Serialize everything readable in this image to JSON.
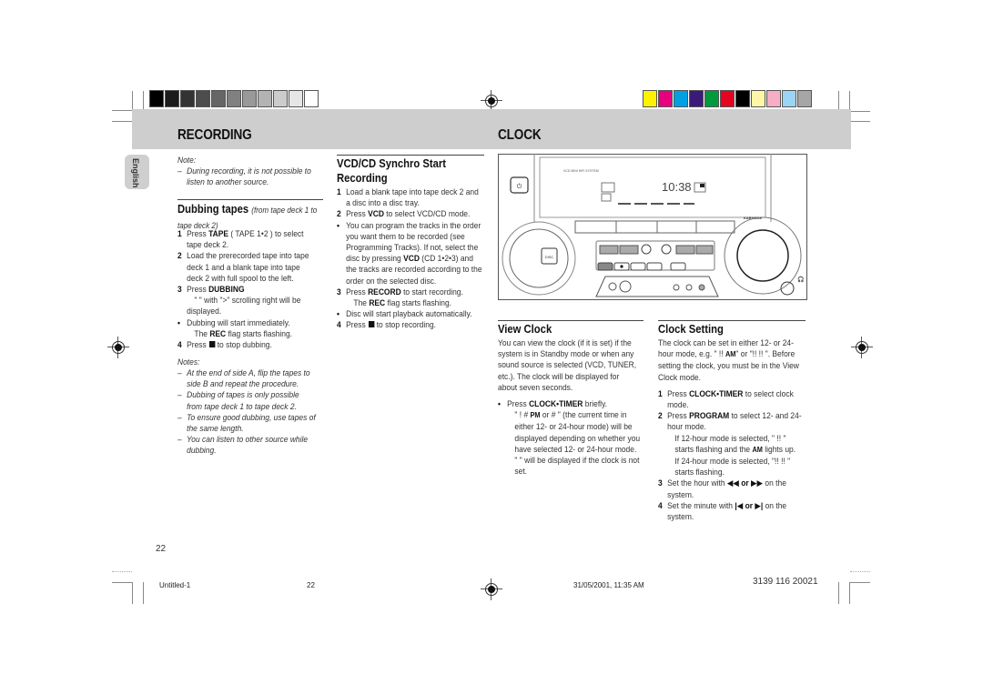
{
  "header": {
    "left_title": "RECORDING",
    "right_title": "CLOCK",
    "language_tab": "English"
  },
  "swatches": {
    "gray": [
      "#000000",
      "#1c1c1c",
      "#333333",
      "#4d4d4d",
      "#666666",
      "#808080",
      "#999999",
      "#b3b3b3",
      "#cccccc",
      "#e6e6e6",
      "#ffffff"
    ],
    "color": [
      "#fff200",
      "#e6007e",
      "#00a0e3",
      "#3b1a7a",
      "#009a3e",
      "#e30521",
      "#000000",
      "#fff6a8",
      "#f6adc6",
      "#9bd4f5",
      "#a6a6a6"
    ]
  },
  "col1": {
    "note_label": "Note:",
    "note_text": "During recording, it is not possible to listen to another source.",
    "dubbing_title": "Dubbing tapes",
    "dubbing_subtitle": "(from tape deck 1 to tape deck 2)",
    "steps": [
      {
        "n": "1",
        "pre": "Press ",
        "bold": "TAPE",
        "post": " ( TAPE 1•2 ) to select tape deck 2."
      },
      {
        "n": "2",
        "pre": "Load the prerecorded tape into tape deck 1 and a blank tape into tape deck 2 with full spool to the left.",
        "bold": "",
        "post": ""
      },
      {
        "n": "3",
        "pre": "Press ",
        "bold": "DUBBING",
        "post": ""
      }
    ],
    "step3_detail": "\"        \" with \">\" scrolling right will be displayed.",
    "bullet1": "Dubbing will start immediately.",
    "bullet1_detail_pre": "The ",
    "bullet1_detail_bold": "REC",
    "bullet1_detail_post": " flag starts flashing.",
    "step4_n": "4",
    "step4_pre": "Press",
    "step4_post": "to stop dubbing.",
    "notes_label": "Notes:",
    "notes": [
      "At the end of side A, flip the tapes to side B and repeat the procedure.",
      "Dubbing of tapes is only possible from tape deck 1 to tape deck 2.",
      "To ensure good dubbing, use tapes of the same length.",
      "You can listen to other source while dubbing."
    ]
  },
  "col2": {
    "title": "VCD/CD Synchro Start Recording",
    "step1": "Load a blank tape into tape deck 2 and a disc into a disc tray.",
    "step2_pre": "Press ",
    "step2_bold": "VCD",
    "step2_post": " to select VCD/CD mode.",
    "bullet1_pre": "You can program the tracks in the order you want them to be recorded (see Programming Tracks). If not,  select the disc by pressing ",
    "bullet1_bold": "VCD",
    "bullet1_post": " (CD 1•2•3) and the tracks are recorded according to the order on the selected disc.",
    "step3_pre": "Press ",
    "step3_bold": "RECORD",
    "step3_post": " to start recording.",
    "step3_detail_pre": "The ",
    "step3_detail_bold": "REC",
    "step3_detail_post": " flag starts flashing.",
    "bullet2": "Disc will start playback automatically.",
    "step4_pre": "Press",
    "step4_post": "to stop recording."
  },
  "device": {
    "brand_text": "VCD MINI HIFI SYSTEM",
    "clock_display": "10:38",
    "disc_button": "DISC",
    "badge": "KARAOKE"
  },
  "view_clock": {
    "title": "View Clock",
    "para": "You can view the clock (if it is set) if the system is in Standby mode or when any sound source is selected (VCD, TUNER, etc.).  The clock will be displayed for about seven seconds.",
    "bullet_pre": "Press ",
    "bullet_bold": "CLOCK•TIMER",
    "bullet_post": " briefly.",
    "detail1_pre": "\" !    #  ",
    "detail1_pm": "PM",
    "detail1_post": " or          # \" (the current time in either 12- or 24-hour mode) will be displayed depending on whether you have selected 12- or 24-hour mode.",
    "detail2": "\"            \" will be displayed if the clock is not set."
  },
  "clock_setting": {
    "title": "Clock Setting",
    "para_pre": "The clock can be set in either 12- or 24-hour mode, e.g. \"      !!   ",
    "para_am": "AM",
    "para_post": "\" or \"!!    !!   \". Before setting the clock, you must be in the View Clock mode.",
    "step1_pre": "Press ",
    "step1_bold": "CLOCK•TIMER",
    "step1_post": " to select clock mode.",
    "step2_pre": "Press ",
    "step2_bold": "PROGRAM",
    "step2_post": " to select 12- and 24-hour mode.",
    "step2_detail1_pre": "If 12-hour mode is selected, \"      !!  \" starts flashing and the ",
    "step2_detail1_am": "AM",
    "step2_detail1_post": " lights up.",
    "step2_detail2": "If 24-hour mode is selected, \"!!    !!  \" starts flashing.",
    "step3_pre": "Set the hour with ",
    "step3_glyphs": "◀◀ or ▶▶",
    "step3_post": "  on the system.",
    "step4_pre": "Set the minute with ",
    "step4_glyphs": "|◀ or ▶|",
    "step4_post": " on the system."
  },
  "footer": {
    "page_number": "22",
    "file_name": "Untitled-1",
    "file_page": "22",
    "timestamp": "31/05/2001, 11:35 AM",
    "part_number": "3139 116 20021"
  }
}
